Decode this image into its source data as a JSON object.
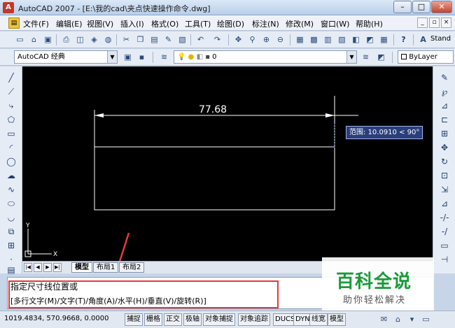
{
  "window": {
    "title": "AutoCAD 2007 - [E:\\我的cad\\夹点快速操作命令.dwg]",
    "min": "–",
    "max": "□",
    "close": "✕"
  },
  "menu": {
    "items": [
      "文件(F)",
      "编辑(E)",
      "视图(V)",
      "插入(I)",
      "格式(O)",
      "工具(T)",
      "绘图(D)",
      "标注(N)",
      "修改(M)",
      "窗口(W)",
      "帮助(H)"
    ],
    "doc_min": "_",
    "doc_restore": "▫",
    "doc_close": "×"
  },
  "toolbar": {
    "text_style": "Stand"
  },
  "workspace": {
    "value": "AutoCAD 经典",
    "layer": "0",
    "linetype": "ByLayer"
  },
  "drawing": {
    "dimension_value": "77.68",
    "tooltip": "范围: 10.0910 < 90°",
    "ucs_x": "X",
    "ucs_y": "Y"
  },
  "tabs": {
    "items": [
      "模型",
      "布局1",
      "布局2"
    ]
  },
  "command": {
    "line1": "指定尺寸线位置或",
    "line2": "[多行文字(M)/文字(T)/角度(A)/水平(H)/垂直(V)/旋转(R)]"
  },
  "status": {
    "coords": "1019.4834, 570.9668, 0.0000",
    "toggles": [
      "捕捉",
      "栅格",
      "正交",
      "极轴",
      "对象捕捉",
      "对象追踪",
      "DUCS",
      "DYN",
      "线宽",
      "模型"
    ]
  },
  "watermark": {
    "main": "百科全说",
    "sub": "助你轻松解决"
  },
  "colors": {
    "canvas": "#000000",
    "annotation": "#e23b3b",
    "watermark": "#1a9a3a"
  }
}
